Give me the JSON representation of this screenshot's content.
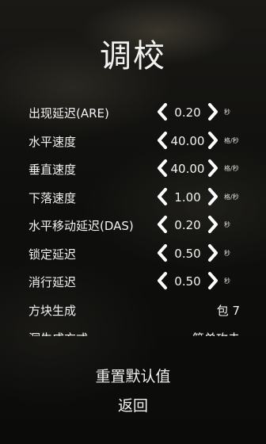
{
  "page": {
    "title": "调校"
  },
  "settings": [
    {
      "label": "出现延迟(ARE)",
      "value": "0.20",
      "unit": "秒"
    },
    {
      "label": "水平速度",
      "value": "40.00",
      "unit": "格/秒"
    },
    {
      "label": "垂直速度",
      "value": "40.00",
      "unit": "格/秒"
    },
    {
      "label": "下落速度",
      "value": "1.00",
      "unit": "格/秒"
    },
    {
      "label": "水平移动延迟(DAS)",
      "value": "0.20",
      "unit": "秒"
    },
    {
      "label": "锁定延迟",
      "value": "0.50",
      "unit": "秒"
    },
    {
      "label": "消行延迟",
      "value": "0.50",
      "unit": "秒"
    }
  ],
  "block_generation": {
    "label": "方块生成",
    "value": "包 7"
  },
  "hole_generation": {
    "label": "洞生成方式",
    "value": "简单攻击"
  },
  "actions": {
    "reset_label": "重置默认值",
    "back_label": "返回"
  },
  "icons": {
    "decrease": "chevron-left-icon",
    "increase": "chevron-right-icon"
  }
}
